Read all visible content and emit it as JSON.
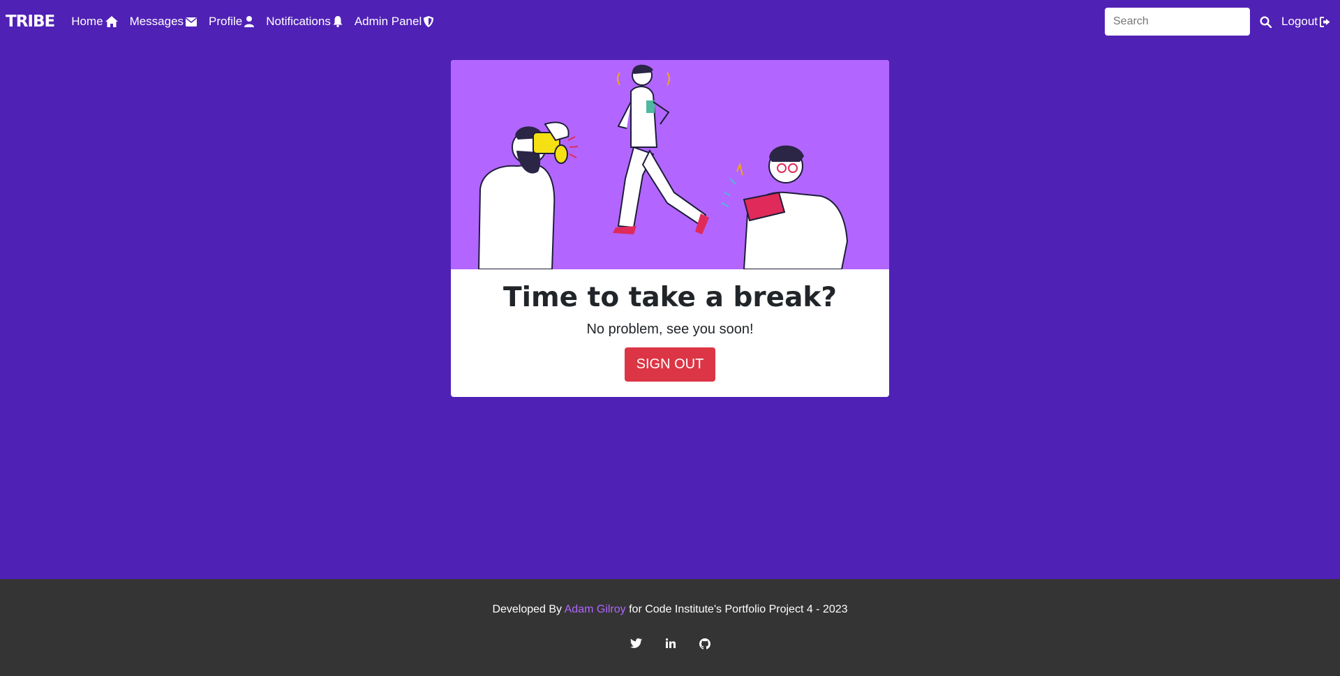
{
  "nav": {
    "brand": "TRIBE",
    "items": [
      {
        "label": "Home",
        "icon": "home-icon"
      },
      {
        "label": "Messages",
        "icon": "envelope-icon"
      },
      {
        "label": "Profile",
        "icon": "user-icon"
      },
      {
        "label": "Notifications",
        "icon": "bell-icon"
      },
      {
        "label": "Admin Panel",
        "icon": "shield-icon"
      }
    ],
    "search_placeholder": "Search",
    "logout_label": "Logout"
  },
  "card": {
    "title": "Time to take a break?",
    "text": "No problem, see you soon!",
    "button_label": "SIGN OUT"
  },
  "footer": {
    "prefix": "Developed By ",
    "author": "Adam Gilroy",
    "suffix": " for Code Institute's Portfolio Project 4 - 2023",
    "socials": [
      "twitter-icon",
      "linkedin-icon",
      "github-icon"
    ]
  },
  "colors": {
    "background": "#5021b5",
    "illustration_bg": "#b266ff",
    "button": "#dc3545",
    "footer_bg": "#343434",
    "link": "#b266ff"
  }
}
